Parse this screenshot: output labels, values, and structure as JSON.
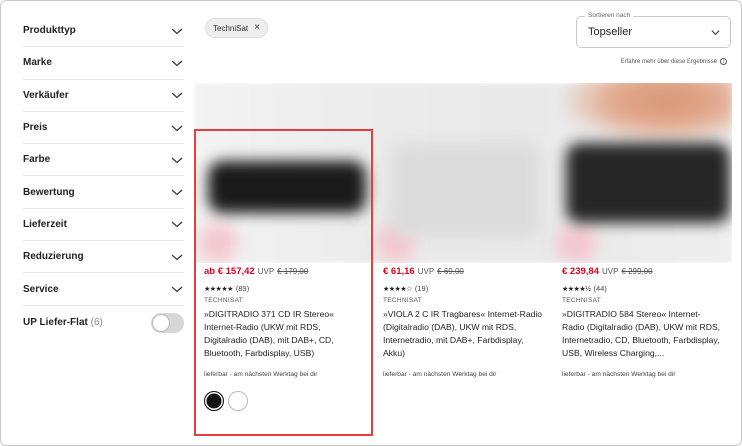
{
  "filters": {
    "items": [
      {
        "label": "Produkttyp"
      },
      {
        "label": "Marke"
      },
      {
        "label": "Verkäufer"
      },
      {
        "label": "Preis"
      },
      {
        "label": "Farbe"
      },
      {
        "label": "Bewertung"
      },
      {
        "label": "Lieferzeit"
      },
      {
        "label": "Reduzierung"
      },
      {
        "label": "Service"
      }
    ],
    "flat": {
      "label": "UP Liefer-Flat",
      "count": "(6)",
      "enabled": false
    }
  },
  "active_chip": {
    "label": "TechniSat",
    "remove_symbol": "×"
  },
  "sort": {
    "legend": "Sortieren nach",
    "value": "Topseller"
  },
  "info": {
    "text": "Erfahre mehr über diese Ergebnisse",
    "icon": "info-icon"
  },
  "products": [
    {
      "price": "ab € 157,42",
      "uvp_label": "UVP",
      "old_price": "€ 179,00",
      "stars": "★★★★★",
      "reviews": "(89)",
      "brand": "TECHNISAT",
      "title": "»DIGITRADIO 371 CD IR Stereo« Internet-Radio (UKW mit RDS, Digitalradio (DAB), mit DAB+, CD, Bluetooth, Farbdisplay, USB)",
      "availability": "lieferbar - am nächsten Werktag bei dir",
      "swatches": [
        "black",
        "white"
      ]
    },
    {
      "price": "€ 61,16",
      "uvp_label": "UVP",
      "old_price": "€ 69,00",
      "stars": "★★★★☆",
      "reviews": "(19)",
      "brand": "TECHNISAT",
      "title": "»VIOLA 2 C IR Tragbares« Internet-Radio (Digitalradio (DAB), UKW mit RDS, Internetradio, mit DAB+, Farbdisplay, Akku)",
      "availability": "lieferbar - am nächsten Werktag bei dir"
    },
    {
      "price": "€ 239,84",
      "uvp_label": "UVP",
      "old_price": "€ 299,00",
      "stars": "★★★★½",
      "reviews": "(44)",
      "brand": "TECHNISAT",
      "title": "»DIGITRADIO 584 Stereo« Internet-Radio (Digitalradio (DAB), UKW mit RDS, Internetradio, CD, Bluetooth, Farbdisplay, USB, Wireless Charging,...",
      "availability": "lieferbar - am nächsten Werktag bei dir"
    }
  ],
  "colors": {
    "price": "#e2001a",
    "highlight": "#e53e3e",
    "toggle_off": "#d7d7d7"
  }
}
